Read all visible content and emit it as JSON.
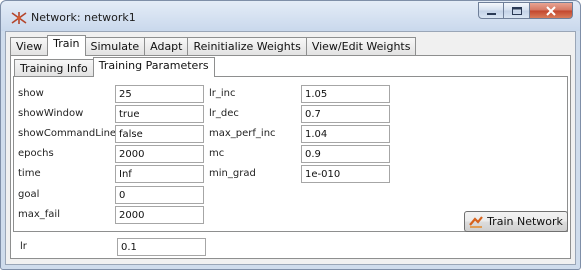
{
  "window": {
    "title": "Network: network1",
    "colors": {
      "titlebar": "#cfdcec",
      "close": "#c7462e"
    }
  },
  "tabs": [
    {
      "label": "View",
      "active": false
    },
    {
      "label": "Train",
      "active": true
    },
    {
      "label": "Simulate",
      "active": false
    },
    {
      "label": "Adapt",
      "active": false
    },
    {
      "label": "Reinitialize Weights",
      "active": false
    },
    {
      "label": "View/Edit Weights",
      "active": false
    }
  ],
  "subtabs": [
    {
      "label": "Training Info",
      "active": false
    },
    {
      "label": "Training Parameters",
      "active": true
    }
  ],
  "params": {
    "show": {
      "label": "show",
      "value": "25"
    },
    "showWindow": {
      "label": "showWindow",
      "value": "true"
    },
    "showCommandLine": {
      "label": "showCommandLine",
      "value": "false"
    },
    "epochs": {
      "label": "epochs",
      "value": "2000"
    },
    "time": {
      "label": "time",
      "value": "Inf"
    },
    "goal": {
      "label": "goal",
      "value": "0"
    },
    "max_fail": {
      "label": "max_fail",
      "value": "2000"
    },
    "lr": {
      "label": "lr",
      "value": "0.1"
    },
    "lr_inc": {
      "label": "lr_inc",
      "value": "1.05"
    },
    "lr_dec": {
      "label": "lr_dec",
      "value": "0.7"
    },
    "max_perf_inc": {
      "label": "max_perf_inc",
      "value": "1.04"
    },
    "mc": {
      "label": "mc",
      "value": "0.9"
    },
    "min_grad": {
      "label": "min_grad",
      "value": "1e-010"
    }
  },
  "buttons": {
    "train_network": "Train Network"
  },
  "icons": {
    "app": "network-app-icon",
    "train": "train-network-icon"
  }
}
